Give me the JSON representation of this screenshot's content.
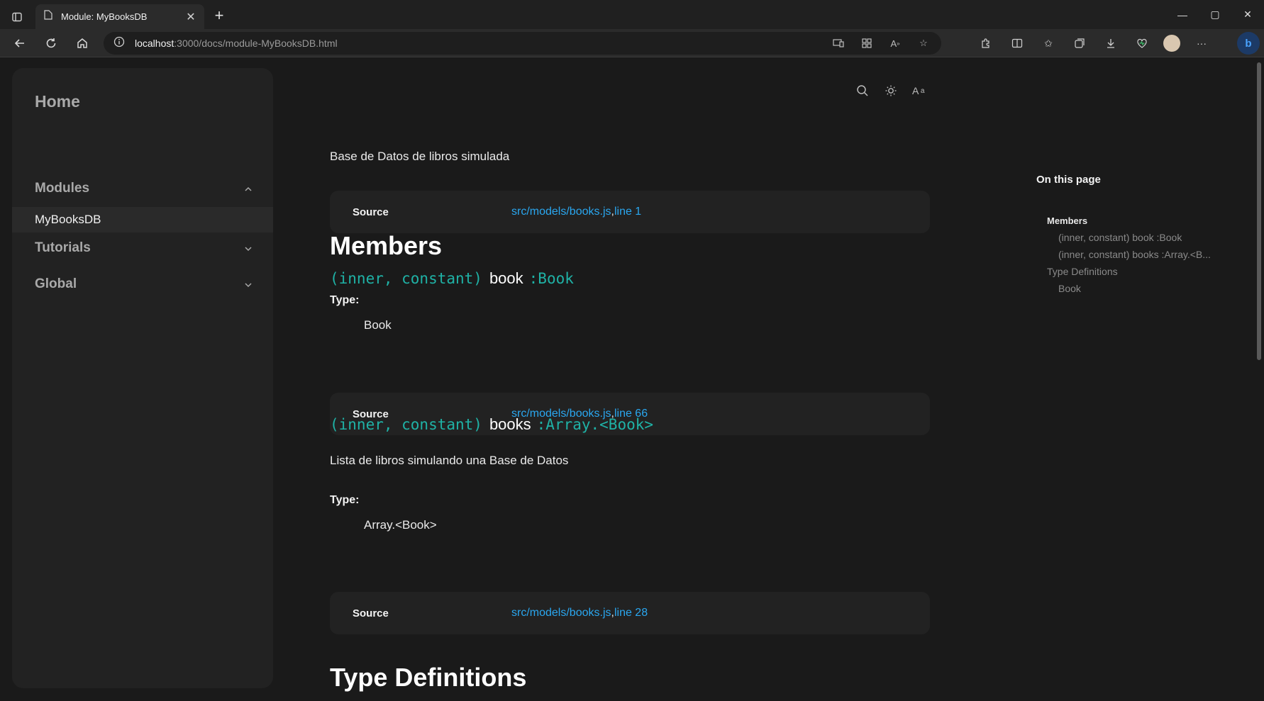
{
  "browser": {
    "tab_title": "Module: MyBooksDB",
    "url_host": "localhost",
    "url_path": ":3000/docs/module-MyBooksDB.html",
    "icons": [
      "tab-actions-icon",
      "page-icon",
      "close-tab-icon",
      "new-tab-icon",
      "minimize-icon",
      "maximize-icon",
      "close-window-icon",
      "back-icon",
      "refresh-icon",
      "home-icon",
      "info-icon",
      "device-icon",
      "apps-icon",
      "read-aloud-icon",
      "favorite-icon",
      "extensions-icon",
      "split-screen-icon",
      "favorites-icon",
      "collections-icon",
      "downloads-icon",
      "performance-icon",
      "profile-avatar",
      "more-icon",
      "copilot-icon"
    ]
  },
  "sidebar": {
    "home": "Home",
    "sections": [
      {
        "label": "Modules",
        "expanded": true
      },
      {
        "label": "Tutorials",
        "expanded": false
      },
      {
        "label": "Global",
        "expanded": false
      }
    ],
    "modules_items": [
      "MyBooksDB"
    ]
  },
  "toolbar_icons": [
    "search-icon",
    "theme-toggle-icon",
    "font-size-icon"
  ],
  "main": {
    "intro": "Base de Datos de libros simulada",
    "source_label": "Source",
    "module_source": {
      "file": "src/models/books.js",
      "sep": ",",
      "line": "line 1"
    },
    "members_heading": "Members",
    "members": [
      {
        "attrs": "(inner, constant)",
        "name": "book",
        "type_sig": ":Book",
        "description": "",
        "type_label": "Type:",
        "type_value": "Book",
        "source": {
          "file": "src/models/books.js",
          "sep": ",",
          "line": "line 66"
        }
      },
      {
        "attrs": "(inner, constant)",
        "name": "books",
        "type_sig": ":Array.<Book>",
        "description": "Lista de libros simulando una Base de Datos",
        "type_label": "Type:",
        "type_value": "Array.<Book>",
        "source": {
          "file": "src/models/books.js",
          "sep": ",",
          "line": "line 28"
        }
      }
    ],
    "typedefs_heading": "Type Definitions"
  },
  "toc": {
    "title": "On this page",
    "items": [
      {
        "label": "Members",
        "level": 1
      },
      {
        "label": "(inner, constant) book :Book",
        "level": 2
      },
      {
        "label": "(inner, constant) books :Array.<B...",
        "level": 2
      },
      {
        "label": "Type Definitions",
        "level": 1
      },
      {
        "label": "Book",
        "level": 2
      }
    ]
  },
  "colors": {
    "background": "#1a1a1a",
    "panel": "#222222",
    "accent_link": "#2aa7f0",
    "signature_teal": "#1fb2a6"
  }
}
